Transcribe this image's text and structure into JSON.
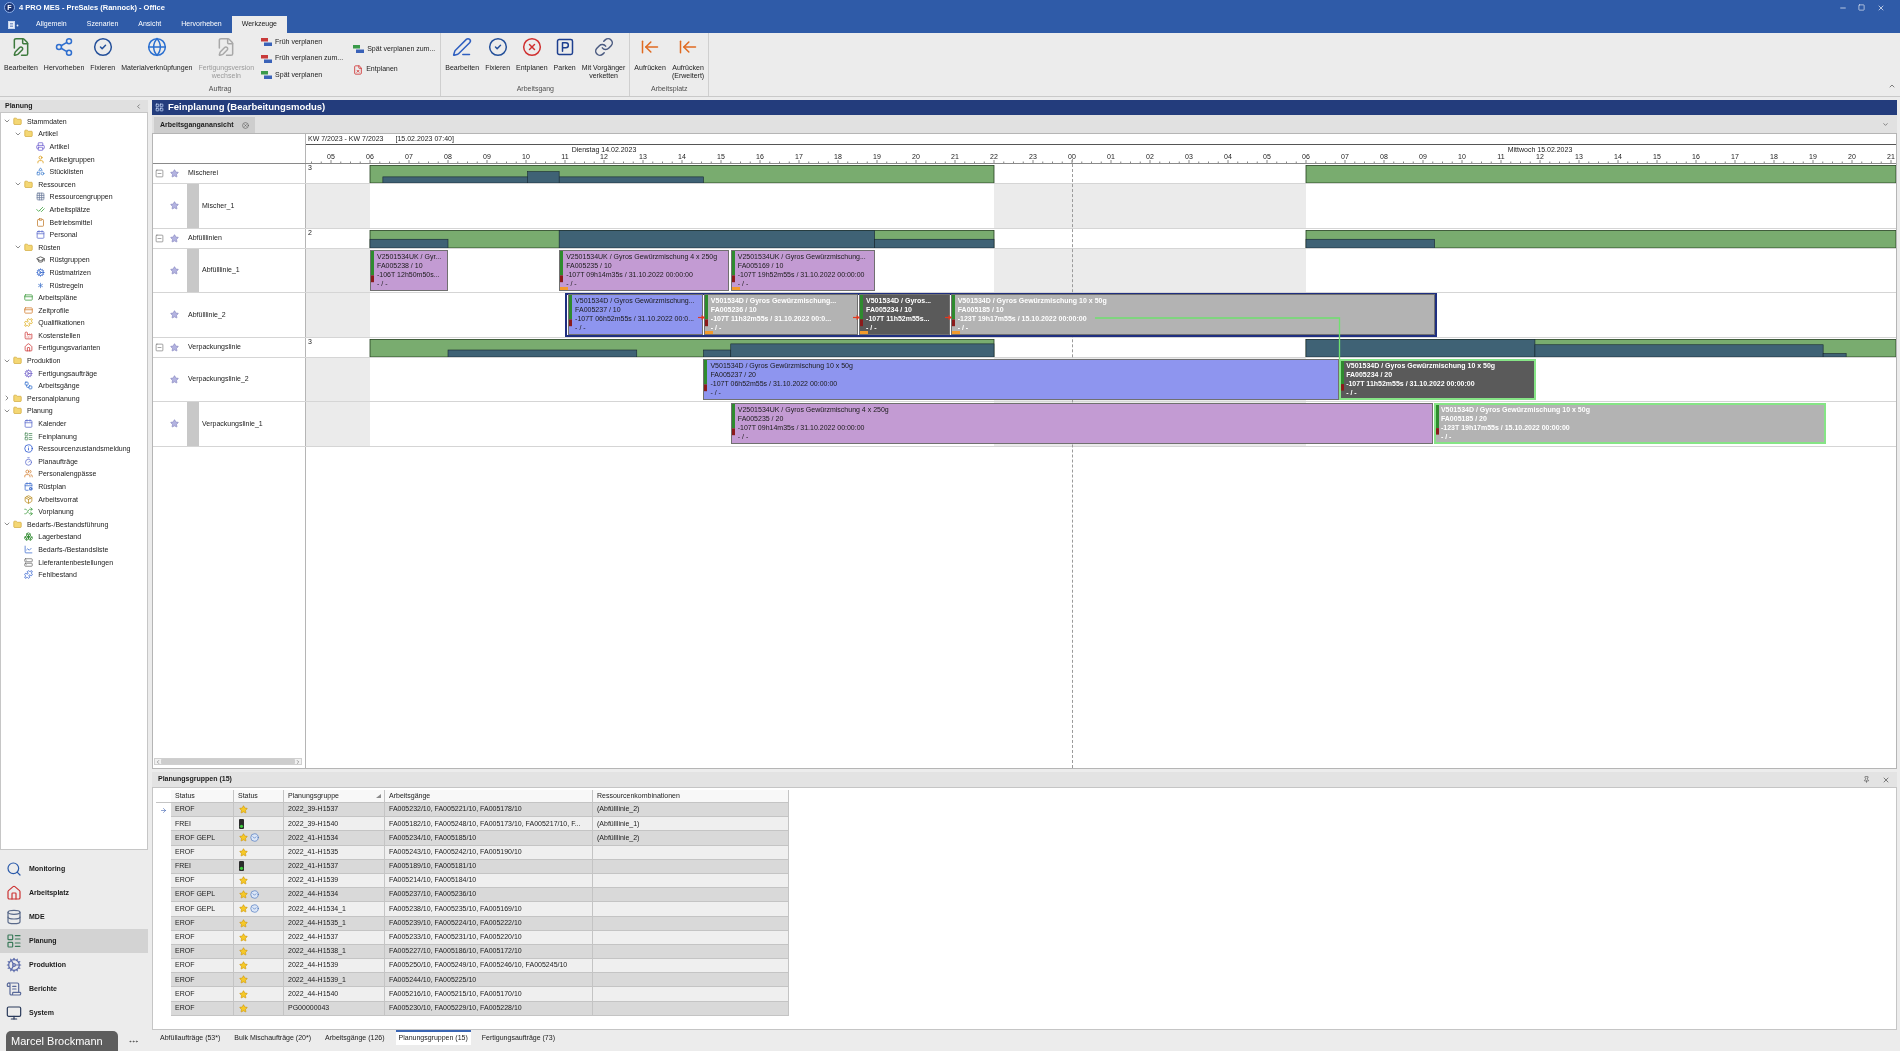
{
  "window": {
    "logo": "F",
    "title": "4 PRO MES - PreSales (Rannock) - Office"
  },
  "ribbon_tabs": [
    {
      "label": "Allgemein",
      "selected": false
    },
    {
      "label": "Szenarien",
      "selected": false
    },
    {
      "label": "Ansicht",
      "selected": false
    },
    {
      "label": "Hervorheben",
      "selected": false
    },
    {
      "label": "Werkzeuge",
      "selected": true
    }
  ],
  "ribbon": {
    "groups": [
      {
        "label": "Auftrag",
        "items": [
          {
            "kind": "large",
            "label": "Bearbeiten",
            "disabled": false
          },
          {
            "kind": "large",
            "label": "Hervorheben",
            "disabled": false
          },
          {
            "kind": "large",
            "label": "Fixieren",
            "disabled": false
          },
          {
            "kind": "large",
            "label": "Materialverknüpfungen",
            "disabled": false
          },
          {
            "kind": "large",
            "label": "Fertigungsversion\nwechseln",
            "disabled": true
          },
          {
            "kind": "stack",
            "entries": [
              "Früh verplanen",
              "Früh verplanen zum...",
              "Spät verplanen"
            ]
          },
          {
            "kind": "stack",
            "entries": [
              "Spät verplanen zum...",
              "Entplanen"
            ]
          }
        ]
      },
      {
        "label": "Arbeitsgang",
        "items": [
          {
            "kind": "large",
            "label": "Bearbeiten",
            "disabled": false
          },
          {
            "kind": "large",
            "label": "Fixieren",
            "disabled": false
          },
          {
            "kind": "large",
            "label": "Entplanen",
            "disabled": false
          },
          {
            "kind": "large",
            "label": "Parken",
            "disabled": false
          },
          {
            "kind": "large",
            "label": "Mit Vorgänger\nverketten",
            "disabled": false
          }
        ]
      },
      {
        "label": "Arbeitsplatz",
        "items": [
          {
            "kind": "large",
            "label": "Aufrücken",
            "disabled": false
          },
          {
            "kind": "large",
            "label": "Aufrücken\n(Erweitert)",
            "disabled": false
          }
        ]
      }
    ]
  },
  "sidebar": {
    "title": "Planung",
    "tree": [
      {
        "label": "Stammdaten",
        "kind": "folder",
        "expanded": true,
        "children": [
          {
            "label": "Artikel",
            "kind": "folder",
            "expanded": true,
            "children": [
              {
                "label": "Artikel",
                "kind": "page"
              },
              {
                "label": "Artikelgruppen",
                "kind": "page"
              },
              {
                "label": "Stücklisten",
                "kind": "page"
              }
            ]
          },
          {
            "label": "Ressourcen",
            "kind": "folder",
            "expanded": true,
            "children": [
              {
                "label": "Ressourcengruppen",
                "kind": "page"
              },
              {
                "label": "Arbeitsplätze",
                "kind": "page"
              },
              {
                "label": "Betriebsmittel",
                "kind": "page"
              },
              {
                "label": "Personal",
                "kind": "page"
              }
            ]
          },
          {
            "label": "Rüsten",
            "kind": "folder",
            "expanded": true,
            "children": [
              {
                "label": "Rüstgruppen",
                "kind": "page"
              },
              {
                "label": "Rüstmatrizen",
                "kind": "page"
              },
              {
                "label": "Rüstregeln",
                "kind": "page"
              }
            ]
          },
          {
            "label": "Arbeitspläne",
            "kind": "page"
          },
          {
            "label": "Zeitprofile",
            "kind": "page"
          },
          {
            "label": "Qualifikationen",
            "kind": "page"
          },
          {
            "label": "Kostenstellen",
            "kind": "page"
          },
          {
            "label": "Fertigungsvarianten",
            "kind": "page"
          }
        ]
      },
      {
        "label": "Produktion",
        "kind": "folder",
        "expanded": true,
        "children": [
          {
            "label": "Fertigungsaufträge",
            "kind": "page"
          },
          {
            "label": "Arbeitsgänge",
            "kind": "page"
          }
        ]
      },
      {
        "label": "Personalplanung",
        "kind": "folder",
        "expanded": false
      },
      {
        "label": "Planung",
        "kind": "folder",
        "expanded": true,
        "children": [
          {
            "label": "Kalender",
            "kind": "page"
          },
          {
            "label": "Feinplanung",
            "kind": "page"
          },
          {
            "label": "Ressourcenzustandsmeldung",
            "kind": "page"
          },
          {
            "label": "Planaufträge",
            "kind": "page"
          },
          {
            "label": "Personalengpässe",
            "kind": "page"
          },
          {
            "label": "Rüstplan",
            "kind": "page"
          },
          {
            "label": "Arbeitsvorrat",
            "kind": "page"
          },
          {
            "label": "Vorplanung",
            "kind": "page"
          }
        ]
      },
      {
        "label": "Bedarfs-/Bestandsführung",
        "kind": "folder",
        "expanded": true,
        "children": [
          {
            "label": "Lagerbestand",
            "kind": "page"
          },
          {
            "label": "Bedarfs-/Bestandsliste",
            "kind": "page"
          },
          {
            "label": "Lieferantenbestellungen",
            "kind": "page"
          },
          {
            "label": "Fehlbestand",
            "kind": "page"
          }
        ]
      }
    ],
    "nav": [
      {
        "label": "Monitoring",
        "selected": false
      },
      {
        "label": "Arbeitsplatz",
        "selected": false
      },
      {
        "label": "MDE",
        "selected": false
      },
      {
        "label": "Planung",
        "selected": true
      },
      {
        "label": "Produktion",
        "selected": false
      },
      {
        "label": "Berichte",
        "selected": false
      },
      {
        "label": "System",
        "selected": false
      }
    ],
    "user": "Marcel Brockmann"
  },
  "document": {
    "title": "Feinplanung (Bearbeitungsmodus)",
    "tabs": [
      {
        "label": "Arbeitsganganansicht",
        "selected": true
      }
    ]
  },
  "gantt": {
    "week_range": "KW 7/2023 - KW 7/2023",
    "timestamp": "[15.02.2023 07:40]",
    "days": [
      "Dienstag 14.02.2023",
      "Mittwoch 15.02.2023"
    ],
    "hours": [
      "05",
      "06",
      "07",
      "08",
      "09",
      "10",
      "11",
      "12",
      "13",
      "14",
      "15",
      "16",
      "17",
      "18",
      "19",
      "20",
      "21",
      "22",
      "23",
      "00",
      "01",
      "02",
      "03",
      "04",
      "05",
      "06",
      "07",
      "08",
      "09",
      "10",
      "11",
      "12",
      "13",
      "14",
      "15",
      "16",
      "17",
      "18",
      "19",
      "20",
      "21"
    ],
    "groups": [
      {
        "label": "Mischerei",
        "expanded": true,
        "capacity": "3",
        "children": [
          {
            "label": "Mischer_1",
            "marker_bar": true,
            "selected": false
          }
        ]
      },
      {
        "label": "Abfülllinien",
        "expanded": true,
        "capacity": "2",
        "children": [
          {
            "label": "Abfülllinie_1",
            "marker_bar": true,
            "selected": false,
            "bars": [
              {
                "lines": [
                  "V2501534UK / Gyr...",
                  "FA005238 / 10",
                  "-106T 12h50m50s...",
                  "- / -"
                ],
                "color": "#c39bd3",
                "kind": "plain"
              },
              {
                "lines": [
                  "V2501534UK / Gyros Gewürzmischung 4 x 250g",
                  "FA005235 / 10",
                  "-107T 09h14m35s / 31.10.2022 00:00:00",
                  "- / -"
                ],
                "color": "#c39bd3",
                "kind": "plain",
                "markers": [
                  {
                    "kind": "setup"
                  }
                ]
              },
              {
                "lines": [
                  "V2501534UK / Gyros Gewürzmischung...",
                  "FA005169 / 10",
                  "-107T 19h52m55s / 31.10.2022 00:00:00",
                  "- / -"
                ],
                "color": "#c39bd3",
                "kind": "plain",
                "markers": [
                  {
                    "kind": "setup"
                  }
                ]
              }
            ]
          },
          {
            "label": "Abfülllinie_2",
            "marker_bar": false,
            "selected": true,
            "bars": [
              {
                "lines": [
                  "V501534D / Gyros Gewürzmischung...",
                  "FA005237 / 10",
                  "-107T 06h52m55s / 31.10.2022 00:0...",
                  "- / -"
                ],
                "color": "#8e95ef",
                "kind": "plain"
              },
              {
                "lines": [
                  "V501534D / Gyros Gewürzmischung...",
                  "FA005236 / 10",
                  "-107T 11h32m55s / 31.10.2022 00:0...",
                  "- / -"
                ],
                "color": "#b3b3b3",
                "kind": "emphasized",
                "markers": [
                  {
                    "kind": "setup"
                  },
                  {
                    "kind": "link"
                  }
                ]
              },
              {
                "lines": [
                  "V501534D / Gyros...",
                  "FA005234 / 10",
                  "-107T 11h52m55s...",
                  "- / -"
                ],
                "color": "#5a5a5a",
                "kind": "emphasized",
                "markers": [
                  {
                    "kind": "setup"
                  },
                  {
                    "kind": "link"
                  }
                ]
              },
              {
                "lines": [
                  "V501534D / Gyros Gewürzmischung 10 x 50g",
                  "FA005185 / 10",
                  "-123T 19h17m55s / 15.10.2022 00:00:00",
                  "- / -"
                ],
                "color": "#b3b3b3",
                "kind": "emphasized",
                "markers": [
                  {
                    "kind": "setup"
                  },
                  {
                    "kind": "link"
                  }
                ]
              }
            ]
          }
        ]
      },
      {
        "label": "Verpackungslinie",
        "expanded": true,
        "capacity": "3",
        "children": [
          {
            "label": "Verpackungslinie_2",
            "marker_bar": false,
            "selected": false,
            "bars": [
              {
                "lines": [
                  "V501534D / Gyros Gewürzmischung 10 x 50g",
                  "FA005237 / 20",
                  "-107T 06h52m55s / 31.10.2022 00:00:00",
                  "- / -"
                ],
                "color": "#8e95ef",
                "kind": "plain"
              },
              {
                "lines": [
                  "V501534D / Gyros Gewürzmischung 10 x 50g",
                  "FA005234 / 20",
                  "-107T 11h52m55s / 31.10.2022 00:00:00",
                  "- / -"
                ],
                "color": "#5a5a5a",
                "kind": "chained"
              }
            ]
          },
          {
            "label": "Verpackungslinie_1",
            "marker_bar": true,
            "selected": false,
            "bars": [
              {
                "lines": [
                  "V2501534UK / Gyros Gewürzmischung 4 x 250g",
                  "FA005235 / 20",
                  "-107T 09h14m35s / 31.10.2022 00:00:00",
                  "- / -"
                ],
                "color": "#c39bd3",
                "kind": "plain"
              },
              {
                "lines": [
                  "V501534D / Gyros Gewürzmischung 10 x 50g",
                  "FA005185 / 20",
                  "-123T 19h17m55s / 15.10.2022 00:00:00",
                  "- / -"
                ],
                "color": "#b3b3b3",
                "kind": "chained"
              }
            ]
          }
        ]
      }
    ]
  },
  "planning_groups": {
    "title": "Planungsgruppen (15)",
    "columns": [
      {
        "label": "Status",
        "sorted": false
      },
      {
        "label": "Status",
        "sorted": false
      },
      {
        "label": "Planungsgruppe",
        "sorted": true
      },
      {
        "label": "Arbeitsgänge",
        "sorted": false
      },
      {
        "label": "Ressourcenkombinationen",
        "sorted": false
      }
    ],
    "rows": [
      {
        "selected": true,
        "status": "EROF",
        "status_icons": [
          {
            "kind": "star"
          }
        ],
        "group": "2022_39-H1537",
        "operations": "FA005232/10, FA005221/10, FA005178/10",
        "resources": "(Abfülllinie_2)"
      },
      {
        "selected": false,
        "status": "FREI",
        "status_icons": [
          {
            "kind": "light"
          }
        ],
        "group": "2022_39-H1540",
        "operations": "FA005182/10, FA005248/10, FA005173/10, FA005217/10, F...",
        "resources": "(Abfülllinie_1)"
      },
      {
        "selected": false,
        "status": "EROF GEPL",
        "status_icons": [
          {
            "kind": "star"
          },
          {
            "kind": "planned"
          }
        ],
        "group": "2022_41-H1534",
        "operations": "FA005234/10, FA005185/10",
        "resources": "(Abfülllinie_2)"
      },
      {
        "selected": false,
        "status": "EROF",
        "status_icons": [
          {
            "kind": "star"
          }
        ],
        "group": "2022_41-H1535",
        "operations": "FA005243/10, FA005242/10, FA005190/10"
      },
      {
        "selected": false,
        "status": "FREI",
        "status_icons": [
          {
            "kind": "light"
          }
        ],
        "group": "2022_41-H1537",
        "operations": "FA005189/10, FA005181/10"
      },
      {
        "selected": false,
        "status": "EROF",
        "status_icons": [
          {
            "kind": "star"
          }
        ],
        "group": "2022_41-H1539",
        "operations": "FA005214/10, FA005184/10"
      },
      {
        "selected": false,
        "status": "EROF GEPL",
        "status_icons": [
          {
            "kind": "star"
          },
          {
            "kind": "planned"
          }
        ],
        "group": "2022_44-H1534",
        "operations": "FA005237/10, FA005236/10"
      },
      {
        "selected": false,
        "status": "EROF GEPL",
        "status_icons": [
          {
            "kind": "star"
          },
          {
            "kind": "planned"
          }
        ],
        "group": "2022_44-H1534_1",
        "operations": "FA005238/10, FA005235/10, FA005169/10"
      },
      {
        "selected": false,
        "status": "EROF",
        "status_icons": [
          {
            "kind": "star"
          }
        ],
        "group": "2022_44-H1535_1",
        "operations": "FA005239/10, FA005224/10, FA005222/10"
      },
      {
        "selected": false,
        "status": "EROF",
        "status_icons": [
          {
            "kind": "star"
          }
        ],
        "group": "2022_44-H1537",
        "operations": "FA005233/10, FA005231/10, FA005220/10"
      },
      {
        "selected": false,
        "status": "EROF",
        "status_icons": [
          {
            "kind": "star"
          }
        ],
        "group": "2022_44-H1538_1",
        "operations": "FA005227/10, FA005186/10, FA005172/10"
      },
      {
        "selected": false,
        "status": "EROF",
        "status_icons": [
          {
            "kind": "star"
          }
        ],
        "group": "2022_44-H1539",
        "operations": "FA005250/10, FA005249/10, FA005246/10, FA005245/10"
      },
      {
        "selected": false,
        "status": "EROF",
        "status_icons": [
          {
            "kind": "star"
          }
        ],
        "group": "2022_44-H1539_1",
        "operations": "FA005244/10, FA005225/10"
      },
      {
        "selected": false,
        "status": "EROF",
        "status_icons": [
          {
            "kind": "star"
          }
        ],
        "group": "2022_44-H1540",
        "operations": "FA005216/10, FA005215/10, FA005170/10"
      },
      {
        "selected": false,
        "status": "EROF",
        "status_icons": [
          {
            "kind": "star"
          }
        ],
        "group": "PG00000043",
        "operations": "FA005230/10, FA005229/10, FA005228/10"
      }
    ]
  },
  "bottom_tabs": [
    {
      "label": "Abfüllaufträge (53*)",
      "selected": false
    },
    {
      "label": "Bulk Mischaufträge (20*)",
      "selected": false
    },
    {
      "label": "Arbeitsgänge (126)",
      "selected": false
    },
    {
      "label": "Planungsgruppen (15)",
      "selected": true
    },
    {
      "label": "Fertigungsaufträge (73)",
      "selected": false
    }
  ]
}
